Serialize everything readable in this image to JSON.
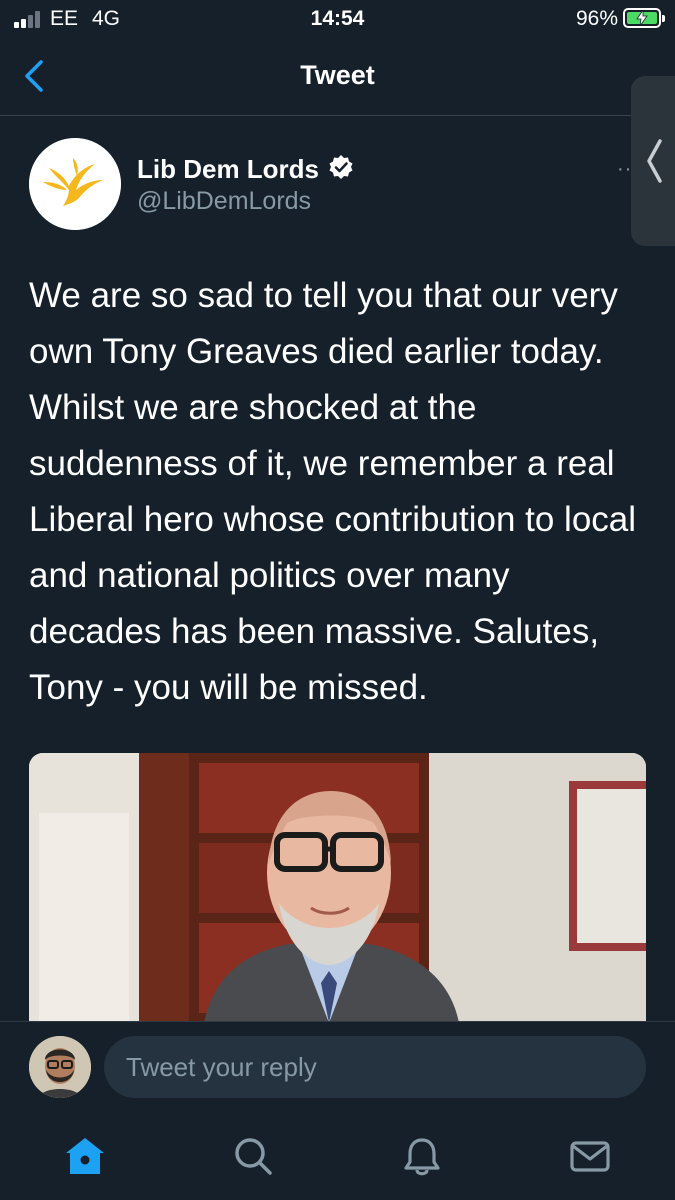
{
  "status_bar": {
    "carrier": "EE",
    "network": "4G",
    "time": "14:54",
    "battery_percent": "96%",
    "battery_level": 0.96,
    "signal_bars_active": 2,
    "signal_bars_total": 4
  },
  "nav": {
    "title": "Tweet",
    "back_icon": "chevron-left-icon"
  },
  "tweet": {
    "author_name": "Lib Dem Lords",
    "author_handle": "@LibDemLords",
    "verified": true,
    "more": "··",
    "text": "We are so sad to tell you that our very own Tony Greaves died earlier today. Whilst we are shocked at the suddenness of it, we remember a real Liberal hero whose contribution to local and national politics over many decades has been massive. Salutes, Tony - you will be missed."
  },
  "reply": {
    "placeholder": "Tweet your reply"
  },
  "tab_bar": {
    "items": [
      {
        "icon": "home-icon",
        "active": true
      },
      {
        "icon": "search-icon",
        "active": false
      },
      {
        "icon": "notifications-icon",
        "active": false
      },
      {
        "icon": "messages-icon",
        "active": false
      }
    ]
  },
  "colors": {
    "background": "#15202b",
    "accent": "#1da1f2",
    "secondary_text": "#8899a6",
    "brand_gold": "#f5b81c"
  }
}
